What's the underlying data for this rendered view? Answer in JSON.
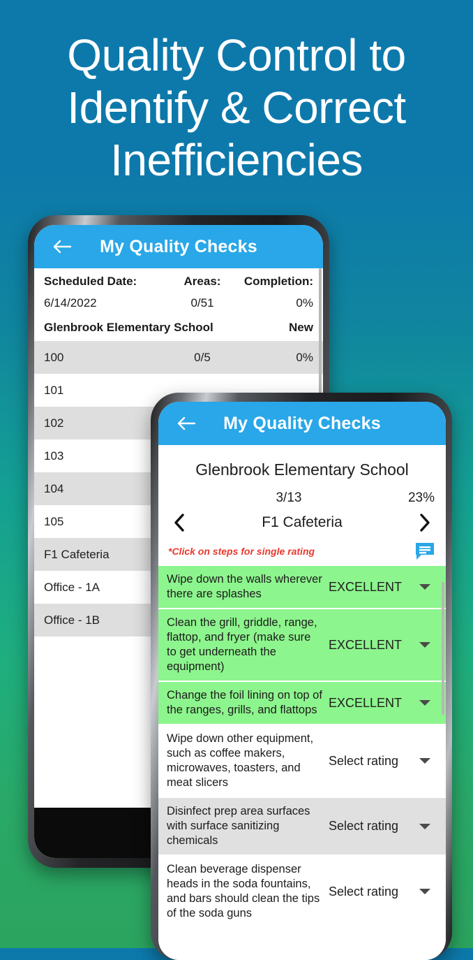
{
  "headline": "Quality Control to Identify & Correct Inefficiencies",
  "colors": {
    "bg_top": "#0d79ab",
    "bg_mid": "#14a093",
    "bg_bottom": "#2ba45f",
    "appbar": "#29a7e8",
    "excellent_row": "#8df58d",
    "hint_red": "#e83a2e",
    "chat_icon": "#29a7e8"
  },
  "phone1": {
    "appbar": {
      "title": "My Quality Checks",
      "back_icon": "arrow-left-icon"
    },
    "summary": {
      "headers": [
        "Scheduled Date:",
        "Areas:",
        "Completion:"
      ],
      "values": [
        "6/14/2022",
        "0/51",
        "0%"
      ],
      "school": "Glenbrook Elementary School",
      "status": "New"
    },
    "areas": [
      {
        "name": "100",
        "count": "0/5",
        "completion": "0%",
        "shaded": true
      },
      {
        "name": "101",
        "count": "",
        "completion": "",
        "shaded": false
      },
      {
        "name": "102",
        "count": "",
        "completion": "",
        "shaded": true
      },
      {
        "name": "103",
        "count": "",
        "completion": "",
        "shaded": false
      },
      {
        "name": "104",
        "count": "",
        "completion": "",
        "shaded": true
      },
      {
        "name": "105",
        "count": "",
        "completion": "",
        "shaded": false
      },
      {
        "name": "F1 Cafeteria",
        "count": "",
        "completion": "",
        "shaded": true
      },
      {
        "name": "Office - 1A",
        "count": "",
        "completion": "",
        "shaded": false
      },
      {
        "name": "Office - 1B",
        "count": "",
        "completion": "",
        "shaded": true
      }
    ],
    "navbar": {
      "glyph": "|||"
    }
  },
  "phone2": {
    "appbar": {
      "title": "My Quality Checks",
      "back_icon": "arrow-left-icon"
    },
    "school": "Glenbrook Elementary School",
    "progress": {
      "count": "3/13",
      "percent": "23%"
    },
    "area": {
      "name": "F1 Cafeteria",
      "prev_icon": "chevron-left-icon",
      "next_icon": "chevron-right-icon"
    },
    "hint": "*Click on steps for single rating",
    "chat_icon": "comment-icon",
    "tasks": [
      {
        "text": "Wipe down the walls wherever there are splashes",
        "rating": "EXCELLENT",
        "style": "excellent"
      },
      {
        "text": "Clean the grill, griddle, range, flattop, and fryer (make sure to get underneath the equipment)",
        "rating": "EXCELLENT",
        "style": "excellent"
      },
      {
        "text": "Change the foil lining on top of the ranges, grills, and flattops",
        "rating": "EXCELLENT",
        "style": "excellent"
      },
      {
        "text": "Wipe down other equipment, such as coffee makers, microwaves, toasters, and meat slicers",
        "rating": "Select rating",
        "style": "white"
      },
      {
        "text": "Disinfect prep area surfaces with surface sanitizing chemicals",
        "rating": "Select rating",
        "style": "grey"
      },
      {
        "text": "Clean beverage dispenser heads in the soda fountains, and bars should clean the tips of the soda guns",
        "rating": "Select rating",
        "style": "white"
      }
    ]
  }
}
